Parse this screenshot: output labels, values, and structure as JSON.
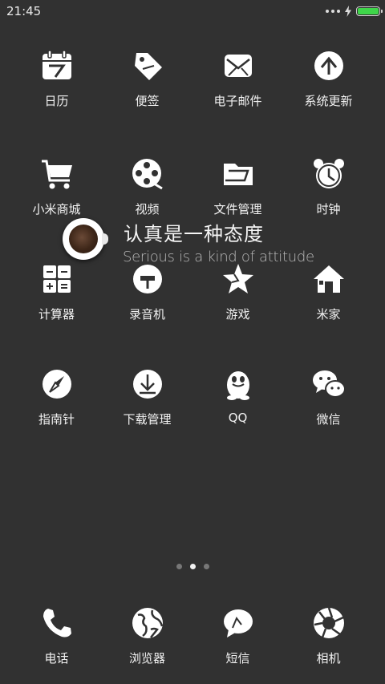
{
  "status_bar": {
    "time": "21:45",
    "battery_color": "#3fd64a"
  },
  "apps": [
    {
      "label": "日历",
      "icon": "calendar-icon"
    },
    {
      "label": "便签",
      "icon": "tag-icon"
    },
    {
      "label": "电子邮件",
      "icon": "mail-icon"
    },
    {
      "label": "系统更新",
      "icon": "update-icon"
    },
    {
      "label": "小米商城",
      "icon": "cart-icon"
    },
    {
      "label": "视频",
      "icon": "film-reel-icon"
    },
    {
      "label": "文件管理",
      "icon": "folder-icon"
    },
    {
      "label": "时钟",
      "icon": "alarm-clock-icon"
    },
    {
      "label": "计算器",
      "icon": "calculator-icon"
    },
    {
      "label": "录音机",
      "icon": "recorder-icon"
    },
    {
      "label": "游戏",
      "icon": "star-icon"
    },
    {
      "label": "米家",
      "icon": "home-icon"
    },
    {
      "label": "指南针",
      "icon": "compass-icon"
    },
    {
      "label": "下载管理",
      "icon": "download-icon"
    },
    {
      "label": "QQ",
      "icon": "qq-penguin-icon"
    },
    {
      "label": "微信",
      "icon": "wechat-icon"
    }
  ],
  "widget": {
    "title": "认真是一种态度",
    "subtitle": "Serious is a kind of attitude",
    "icon": "coffee-cup-icon"
  },
  "pager": {
    "pages": 3,
    "active": 2
  },
  "dock": [
    {
      "label": "电话",
      "icon": "phone-icon"
    },
    {
      "label": "浏览器",
      "icon": "globe-icon"
    },
    {
      "label": "短信",
      "icon": "message-bubble-icon"
    },
    {
      "label": "相机",
      "icon": "camera-aperture-icon"
    }
  ]
}
